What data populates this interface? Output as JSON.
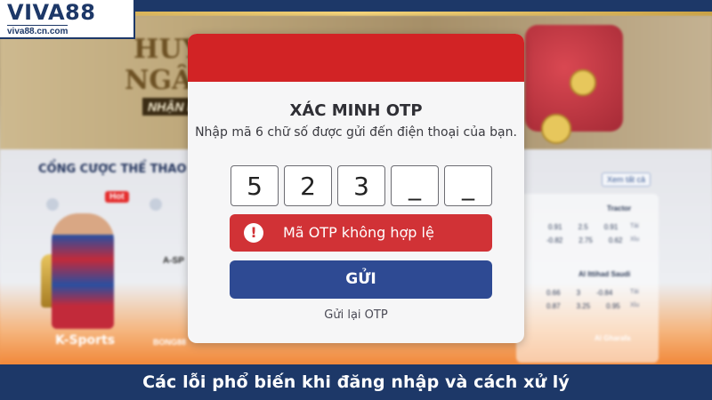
{
  "brand": {
    "logo_text": "VIVA88",
    "logo_url": "viva88.cn.com"
  },
  "background_page": {
    "banner_line_1": "HUY",
    "banner_line_2": "NGÂN",
    "banner_line_3": "NHẬN N",
    "section_title": "CỔNG CƯỢC THỂ THAO",
    "hot_tag": "Hot",
    "provider_1": "K-Sports",
    "provider_2": "A-SP",
    "provider_3": "BONG88",
    "see_all": "Xem tất cả",
    "odds": {
      "team_1": "Tractor",
      "team_2": "Al Ittihad Saudi",
      "team_3": "Al Gharafa",
      "row_1": [
        "0.91",
        "2.5",
        "0.91"
      ],
      "row_2": [
        "-0.82",
        "2.75",
        "0.62"
      ],
      "row_3": [
        "0.66",
        "3",
        "-0.84"
      ],
      "row_4": [
        "0.87",
        "3.25",
        "0.95"
      ],
      "side_tai": "Tài",
      "side_xiu": "Xỉu"
    }
  },
  "modal": {
    "title": "XÁC MINH OTP",
    "description": "Nhập mã 6 chữ số được gửi đến điện thoại của bạn.",
    "otp_digits": [
      "5",
      "2",
      "3",
      "_",
      "_"
    ],
    "error_icon": "!",
    "error_message": "Mã OTP không hợp lệ",
    "submit_label": "GỬI",
    "resend_label": "Gửi lại OTP"
  },
  "caption": "Các lỗi phổ biến khi đăng nhập và cách xử lý",
  "colors": {
    "frame": "#1d3868",
    "modal_header": "#d22325",
    "error": "#d13236",
    "submit": "#2e4a93",
    "accent_gold": "#caa246"
  }
}
